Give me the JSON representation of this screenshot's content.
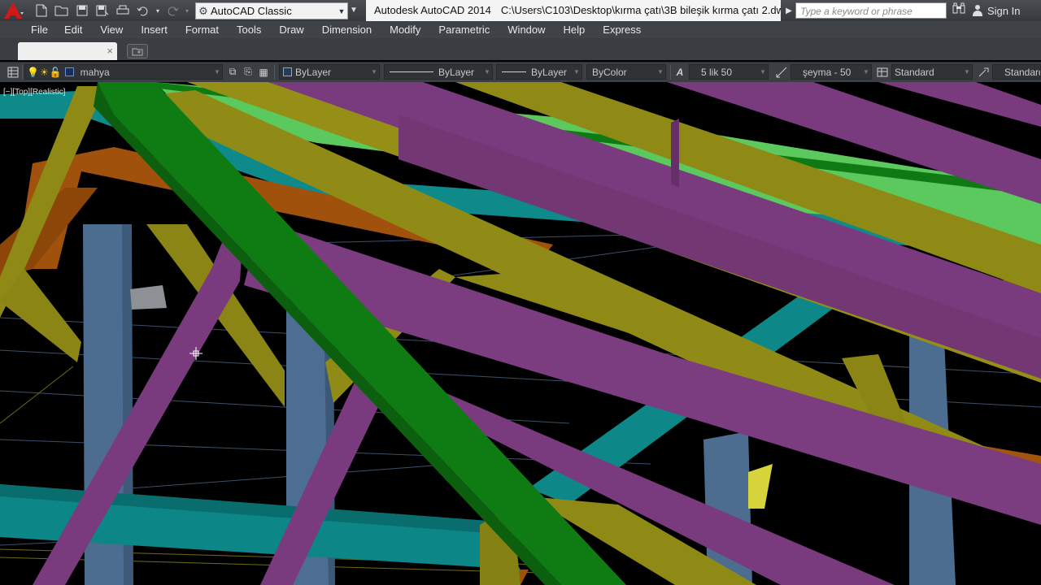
{
  "titlebar": {
    "workspace": "AutoCAD Classic",
    "window_title": {
      "app": "Autodesk AutoCAD 2014",
      "path": "C:\\Users\\C103\\Desktop\\kırma çatı\\3B bileşik kırma çatı 2.dwg"
    },
    "search_placeholder": "Type a keyword or phrase",
    "signin": "Sign In",
    "quick_access_icons": [
      "new-icon",
      "open-icon",
      "save-icon",
      "save-as-icon",
      "plot-icon",
      "undo-icon",
      "redo-icon"
    ]
  },
  "menubar": {
    "items": [
      "File",
      "Edit",
      "View",
      "Insert",
      "Format",
      "Tools",
      "Draw",
      "Dimension",
      "Modify",
      "Parametric",
      "Window",
      "Help",
      "Express"
    ]
  },
  "tabs": {
    "file_tab_label": "",
    "close_glyph": "×"
  },
  "properties": {
    "layer": "mahya",
    "color": "ByLayer",
    "linetype": "ByLayer",
    "lineweight": "ByLayer",
    "plotstyle": "ByColor",
    "text_style": "5 lik 50",
    "dim_style": "şeyma - 50",
    "table_style": "Standard",
    "multileader_style": "Standard"
  },
  "viewport": {
    "label": "[−][Top][Realistic]"
  },
  "colors": {
    "magenta_beam": "#7a3a7e",
    "green_beam": "#0f7c13",
    "olive_beam": "#8f8a16",
    "teal_beam": "#0e8b8b",
    "orange_beam": "#a0530c",
    "light_green": "#59c95b",
    "post_blue": "#4e6f92"
  }
}
